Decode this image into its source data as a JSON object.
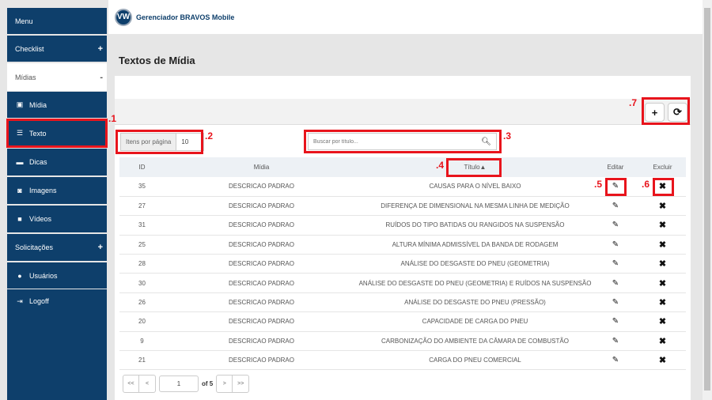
{
  "header": {
    "brand": "Gerenciador BRAVOS Mobile",
    "logo": "VW"
  },
  "sidebar": {
    "items": [
      {
        "label": "Menu"
      },
      {
        "label": "Checklist",
        "toggle": "+"
      },
      {
        "label": "Mídias",
        "toggle": "-"
      },
      {
        "label": "Mídia",
        "icon": "film-icon"
      },
      {
        "label": "Texto",
        "icon": "list-icon"
      },
      {
        "label": "Dicas",
        "icon": "comment-icon"
      },
      {
        "label": "Imagens",
        "icon": "camera-icon"
      },
      {
        "label": "Vídeos",
        "icon": "video-icon"
      },
      {
        "label": "Solicitações",
        "toggle": "+"
      },
      {
        "label": "Usuários",
        "icon": "user-icon"
      },
      {
        "label": "Logoff",
        "icon": "logout-icon"
      }
    ]
  },
  "page": {
    "title": "Textos de Mídia"
  },
  "toolbar": {
    "add": "+",
    "refresh": "⟳"
  },
  "filters": {
    "items_label": "Itens por página",
    "items_value": "10",
    "search_placeholder": "Buscar por título..."
  },
  "table": {
    "headers": [
      "ID",
      "Mídia",
      "Título▲",
      "Editar",
      "Excluir"
    ],
    "rows": [
      [
        "35",
        "DESCRICAO PADRAO",
        "CAUSAS PARA O NÍVEL BAIXO"
      ],
      [
        "27",
        "DESCRICAO PADRAO",
        "DIFERENÇA DE DIMENSIONAL NA MESMA LINHA DE MEDIÇÃO"
      ],
      [
        "31",
        "DESCRICAO PADRAO",
        "RUÍDOS DO TIPO BATIDAS OU RANGIDOS NA SUSPENSÃO"
      ],
      [
        "25",
        "DESCRICAO PADRAO",
        "ALTURA MÍNIMA ADMISSÍVEL DA BANDA DE RODAGEM"
      ],
      [
        "28",
        "DESCRICAO PADRAO",
        "ANÁLISE DO DESGASTE DO PNEU (GEOMETRIA)"
      ],
      [
        "30",
        "DESCRICAO PADRAO",
        "ANÁLISE DO DESGASTE DO PNEU (GEOMETRIA) E RUÍDOS NA SUSPENSÃO"
      ],
      [
        "26",
        "DESCRICAO PADRAO",
        "ANÁLISE DO DESGASTE DO PNEU (PRESSÃO)"
      ],
      [
        "20",
        "DESCRICAO PADRAO",
        "CAPACIDADE DE CARGA DO PNEU"
      ],
      [
        "9",
        "DESCRICAO PADRAO",
        "CARBONIZAÇÃO DO AMBIENTE DA CÂMARA DE COMBUSTÃO"
      ],
      [
        "21",
        "DESCRICAO PADRAO",
        "CARGA DO PNEU COMERCIAL"
      ]
    ]
  },
  "pagination": {
    "first": "<<",
    "prev": "<",
    "page": "1",
    "of": "of 5",
    "next": ">",
    "last": ">>"
  },
  "annotations": [
    ".1",
    ".2",
    ".3",
    ".4",
    ".5",
    ".6",
    ".7"
  ],
  "colors": {
    "sidebar": "#0e3f6b",
    "annotation": "#e8141c"
  }
}
